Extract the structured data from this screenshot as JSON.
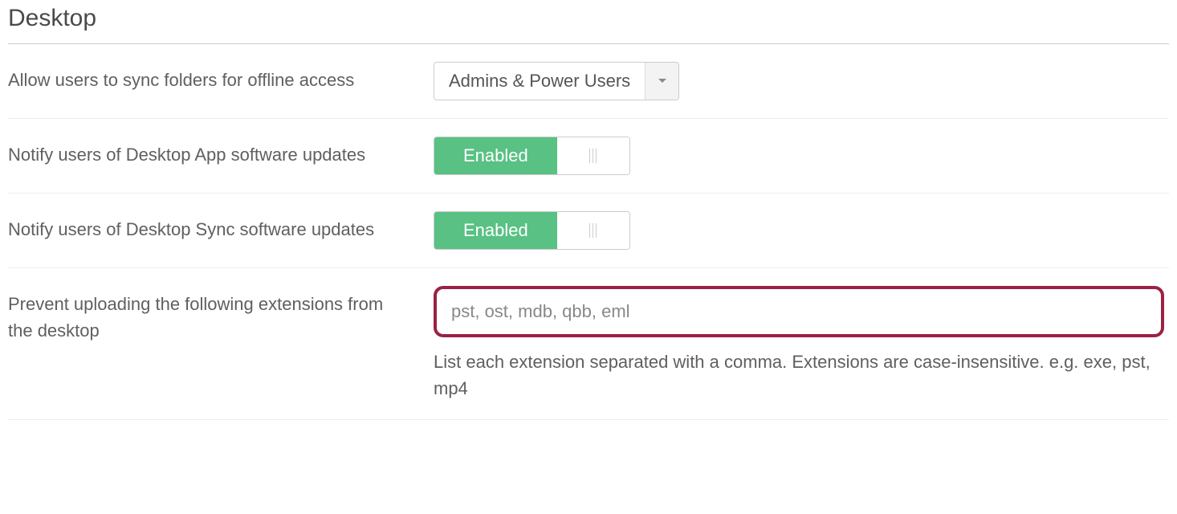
{
  "section": {
    "title": "Desktop"
  },
  "settings": {
    "sync_offline": {
      "label": "Allow users to sync folders for offline access",
      "selected": "Admins & Power Users"
    },
    "notify_app_updates": {
      "label": "Notify users of Desktop App software updates",
      "state": "Enabled"
    },
    "notify_sync_updates": {
      "label": "Notify users of Desktop Sync software updates",
      "state": "Enabled"
    },
    "prevent_extensions": {
      "label": "Prevent uploading the following extensions from the desktop",
      "value": "pst, ost, mdb, qbb, eml",
      "help": "List each extension separated with a comma. Extensions are case-insensitive. e.g. exe, pst, mp4"
    }
  }
}
